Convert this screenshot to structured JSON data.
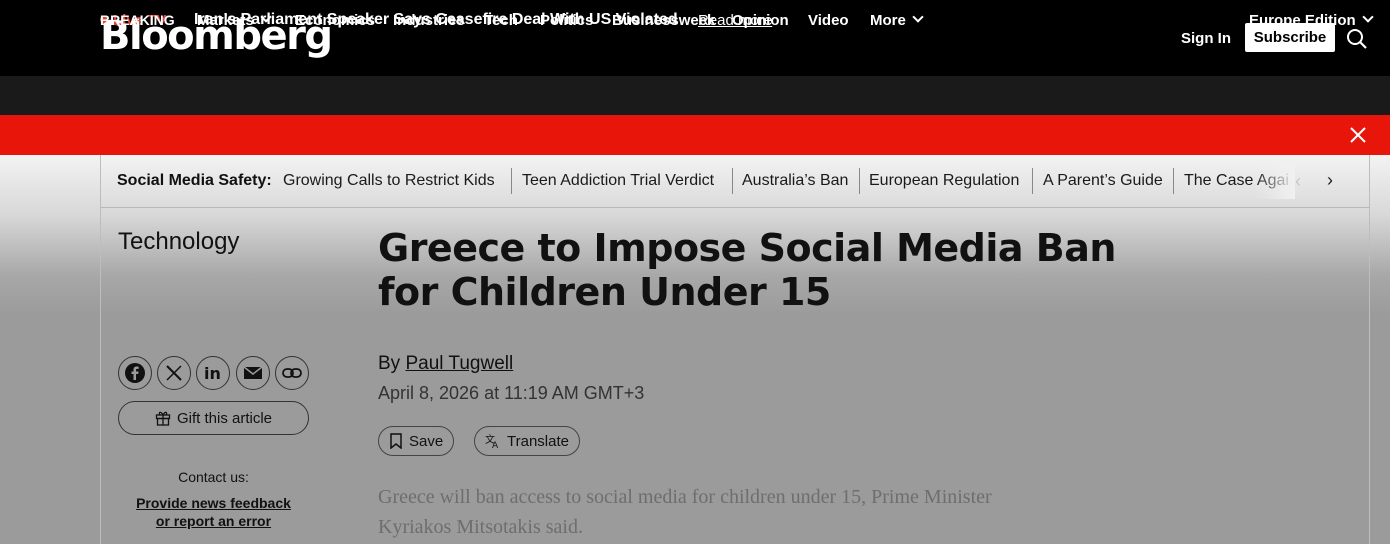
{
  "header": {
    "logo": "Bloomberg",
    "sign_in": "Sign In",
    "subscribe": "Subscribe",
    "search_icon": "search-icon"
  },
  "nav": {
    "live": "Live TV",
    "items": [
      "Markets",
      "Economics",
      "Industries",
      "Tech",
      "Politics",
      "Businessweek",
      "Opinion",
      "Video",
      "More"
    ],
    "edition": "Europe Edition"
  },
  "breaking": {
    "label": "BREAKING",
    "headline": "Iran’s Parliament Speaker Says Ceasefire Deal With US Violated",
    "link": "Read more"
  },
  "topics": {
    "label": "Social Media Safety:",
    "items": [
      "Growing Calls to Restrict Kids",
      "Teen Addiction Trial Verdict",
      "Australia’s Ban",
      "European Regulation",
      "A Parent’s Guide",
      "The Case Agai"
    ]
  },
  "article": {
    "section": "Technology",
    "headline": "Greece to Impose Social Media Ban for Children Under 15",
    "byline_prefix": "By",
    "author": "Paul Tugwell",
    "date": "April 8, 2026 at 11:19 AM GMT+3",
    "save_label": "Save",
    "translate_label": "Translate",
    "body": "Greece will ban access to social media for children under 15, Prime Minister Kyriakos Mitsotakis said."
  },
  "sidebar": {
    "share_icons": [
      "facebook-icon",
      "x-icon",
      "linkedin-icon",
      "email-icon",
      "link-icon"
    ],
    "gift_label": "Gift this article",
    "contact_label": "Contact us:",
    "feedback_line1": "Provide news feedback",
    "feedback_line2": "or report an error"
  },
  "colors": {
    "breaking_bg": "#e8150b",
    "live": "#e8442f",
    "nav_bg": "#1a1a1a"
  }
}
